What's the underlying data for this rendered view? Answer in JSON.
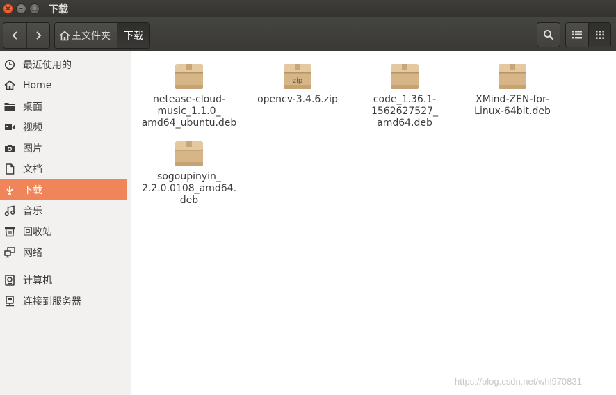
{
  "window": {
    "title": "下载"
  },
  "toolbar": {
    "back_icon": "chevron-left-icon",
    "forward_icon": "chevron-right-icon",
    "breadcrumbs": [
      {
        "label": "主文件夹",
        "icon": "home-icon"
      },
      {
        "label": "下载"
      }
    ],
    "search_icon": "search-icon",
    "list_view_icon": "list-view-icon",
    "grid_view_icon": "grid-view-icon"
  },
  "sidebar": {
    "items": [
      {
        "label": "最近使用的",
        "icon": "clock-icon"
      },
      {
        "label": "Home",
        "icon": "home-icon"
      },
      {
        "label": "桌面",
        "icon": "folder-icon"
      },
      {
        "label": "视频",
        "icon": "video-icon"
      },
      {
        "label": "图片",
        "icon": "camera-icon"
      },
      {
        "label": "文档",
        "icon": "document-icon"
      },
      {
        "label": "下载",
        "icon": "download-icon",
        "active": true
      },
      {
        "label": "音乐",
        "icon": "music-icon"
      },
      {
        "label": "回收站",
        "icon": "trash-icon"
      },
      {
        "label": "网络",
        "icon": "network-icon"
      }
    ],
    "devices": [
      {
        "label": "计算机",
        "icon": "computer-icon"
      },
      {
        "label": "连接到服务器",
        "icon": "server-icon"
      }
    ]
  },
  "files": [
    {
      "name": "netease-cloud-\nmusic_1.1.0_\namd64_ubuntu.deb",
      "icon": "package-icon"
    },
    {
      "name": "opencv-3.4.6.zip",
      "icon": "zip-package-icon",
      "badge": "zip"
    },
    {
      "name": "code_1.36.1-\n1562627527_\namd64.deb",
      "icon": "package-icon"
    },
    {
      "name": "XMind-ZEN-for-\nLinux-64bit.deb",
      "icon": "package-icon"
    },
    {
      "name": "sogoupinyin_\n2.2.0.0108_amd64.\ndeb",
      "icon": "package-icon"
    }
  ],
  "watermark": "https://blog.csdn.net/whl970831",
  "colors": {
    "accent": "#f0855a",
    "titlebar": "#3c3b37",
    "sidebar": "#f2f1f0",
    "package": "#d8b78a"
  }
}
